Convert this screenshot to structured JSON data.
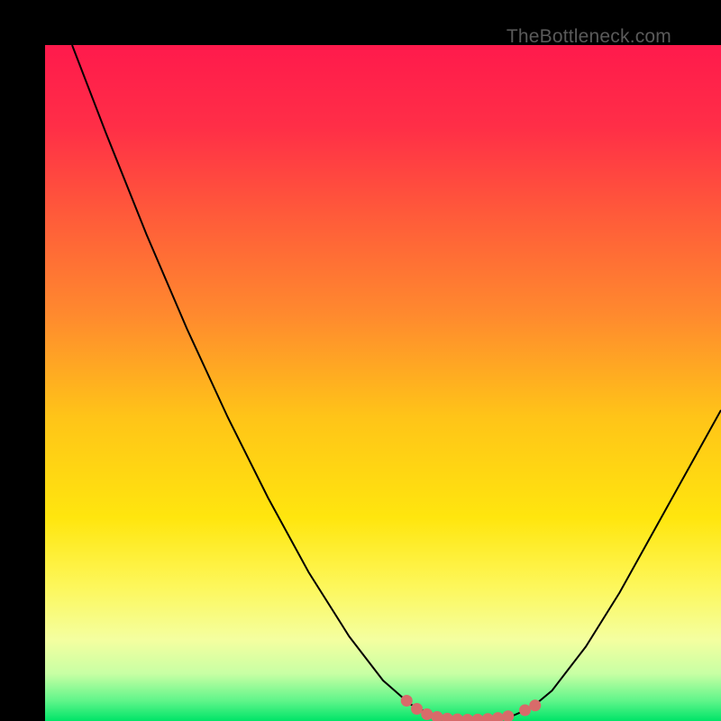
{
  "watermark": "TheBottleneck.com",
  "chart_data": {
    "type": "line",
    "title": "",
    "xlabel": "",
    "ylabel": "",
    "xlim": [
      0,
      100
    ],
    "ylim": [
      0,
      100
    ],
    "background_gradient": {
      "stops": [
        {
          "offset": 0.0,
          "color": "#ff1a4c"
        },
        {
          "offset": 0.12,
          "color": "#ff2e47"
        },
        {
          "offset": 0.25,
          "color": "#ff5a3a"
        },
        {
          "offset": 0.4,
          "color": "#ff8a2e"
        },
        {
          "offset": 0.55,
          "color": "#ffc418"
        },
        {
          "offset": 0.7,
          "color": "#ffe60e"
        },
        {
          "offset": 0.8,
          "color": "#fdf75a"
        },
        {
          "offset": 0.88,
          "color": "#f4ffa0"
        },
        {
          "offset": 0.93,
          "color": "#c8ffa4"
        },
        {
          "offset": 0.97,
          "color": "#60f58a"
        },
        {
          "offset": 1.0,
          "color": "#00e468"
        }
      ]
    },
    "series": [
      {
        "name": "bottleneck-curve",
        "color": "#000000",
        "width": 2,
        "points": [
          {
            "x": 4.0,
            "y": 100.0
          },
          {
            "x": 9.0,
            "y": 87.0
          },
          {
            "x": 15.0,
            "y": 72.0
          },
          {
            "x": 21.0,
            "y": 58.0
          },
          {
            "x": 27.0,
            "y": 45.0
          },
          {
            "x": 33.0,
            "y": 33.0
          },
          {
            "x": 39.0,
            "y": 22.0
          },
          {
            "x": 45.0,
            "y": 12.5
          },
          {
            "x": 50.0,
            "y": 6.0
          },
          {
            "x": 54.0,
            "y": 2.5
          },
          {
            "x": 57.0,
            "y": 1.0
          },
          {
            "x": 60.0,
            "y": 0.3
          },
          {
            "x": 63.0,
            "y": 0.2
          },
          {
            "x": 66.0,
            "y": 0.3
          },
          {
            "x": 69.0,
            "y": 0.7
          },
          {
            "x": 72.0,
            "y": 2.0
          },
          {
            "x": 75.0,
            "y": 4.5
          },
          {
            "x": 80.0,
            "y": 11.0
          },
          {
            "x": 85.0,
            "y": 19.0
          },
          {
            "x": 90.0,
            "y": 28.0
          },
          {
            "x": 95.0,
            "y": 37.0
          },
          {
            "x": 100.0,
            "y": 46.0
          }
        ]
      }
    ],
    "note_markers": {
      "color": "#d86b6a",
      "points": [
        {
          "x": 53.5,
          "y": 3.0
        },
        {
          "x": 55.0,
          "y": 1.8
        },
        {
          "x": 56.5,
          "y": 1.0
        },
        {
          "x": 58.0,
          "y": 0.6
        },
        {
          "x": 59.5,
          "y": 0.35
        },
        {
          "x": 61.0,
          "y": 0.25
        },
        {
          "x": 62.5,
          "y": 0.2
        },
        {
          "x": 64.0,
          "y": 0.22
        },
        {
          "x": 65.5,
          "y": 0.3
        },
        {
          "x": 67.0,
          "y": 0.45
        },
        {
          "x": 68.5,
          "y": 0.7
        },
        {
          "x": 71.0,
          "y": 1.6
        },
        {
          "x": 72.5,
          "y": 2.3
        }
      ]
    }
  }
}
